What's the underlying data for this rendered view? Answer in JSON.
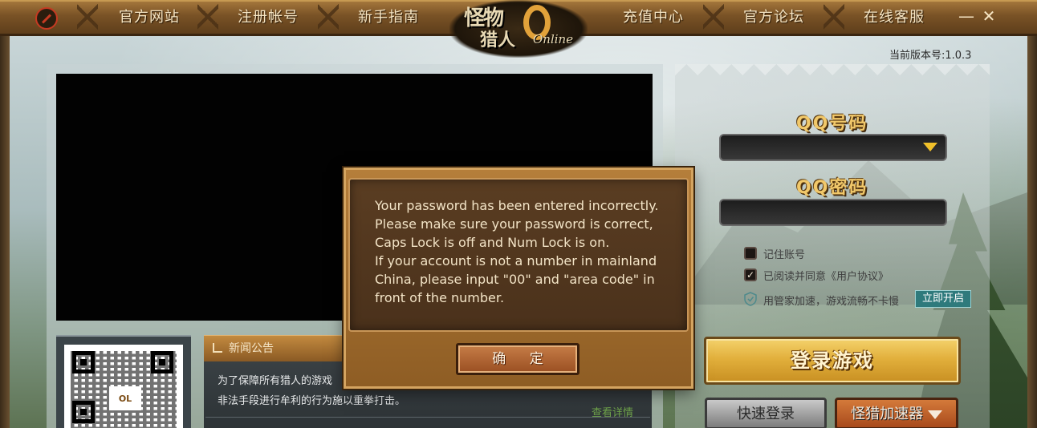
{
  "window": {
    "version": "当前版本号:1.0.3",
    "minimize_glyph": "—",
    "close_glyph": "✕"
  },
  "nav": {
    "items": [
      {
        "label": "官方网站"
      },
      {
        "label": "注册帐号"
      },
      {
        "label": "新手指南"
      },
      {
        "label": "充值中心"
      },
      {
        "label": "官方论坛"
      },
      {
        "label": "在线客服"
      }
    ]
  },
  "logo": {
    "line1": "怪物",
    "line2": "猎人",
    "suffix": "Online"
  },
  "news": {
    "title": "新闻公告",
    "lines": [
      "为了保障所有猎人的游戏",
      "非法手段进行牟利的行为施以重拳打击。"
    ],
    "more": "查看详情"
  },
  "qr": {
    "center_text": "OL"
  },
  "login": {
    "qq_number_label": "QQ号码",
    "qq_password_label": "QQ密码",
    "qq_number_value": "",
    "qq_password_value": "",
    "remember_label": "记住账号",
    "remember_checked": false,
    "agree_label": "已阅读并同意《用户协议》",
    "agree_checked": true,
    "accel_note": "用管家加速，游戏流畅不卡慢",
    "open_now": "立即开启",
    "login_button": "登录游戏",
    "quick_login": "快速登录",
    "accelerator": "怪猎加速器"
  },
  "dialog": {
    "message": "Your password has been entered incorrectly.\nPlease make sure your password is correct,\nCaps Lock is off and Num Lock is on.\nIf your account is not a number in mainland\nChina, please input \"00\" and \"area code\" in\nfront of the number.",
    "ok_button": "确 定"
  },
  "colors": {
    "accent_gold": "#f1c86a",
    "nav_text": "#f7e6c4",
    "dialog_bg": "#4a311b",
    "link_green": "#6ea24a",
    "open_now_bg": "#2e7a7c"
  },
  "icons": [
    "app-logo-icon",
    "dropdown-arrow-icon",
    "checkbox-icon",
    "shield-icon",
    "news-icon",
    "minimize-icon",
    "close-icon"
  ]
}
